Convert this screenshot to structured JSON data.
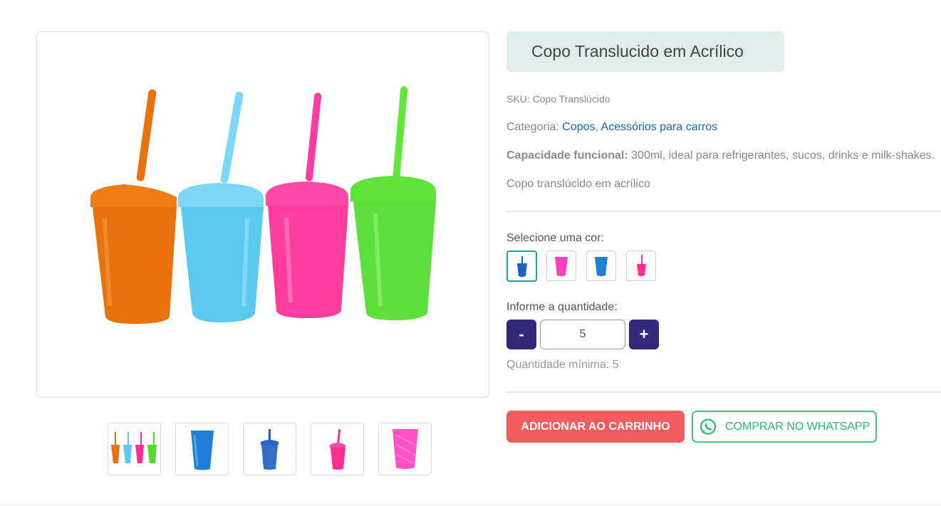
{
  "product": {
    "title": "Copo Translucido em Acrílico",
    "sku_text": "SKU: Copo Translúcido",
    "category_label": "Categoria: ",
    "category_links": [
      "Copos",
      "Acessórios para carros"
    ],
    "category_separator": ", ",
    "capacity_label": "Capacidade funcional:",
    "capacity_text": " 300ml, ideal para refrigerantes, sucos, drinks e milk-shakes.",
    "description": "Copo translúcido em acrílico"
  },
  "color_select": {
    "label": "Selecione uma cor:",
    "options": [
      {
        "name": "Azul escuro com canudo",
        "color": "#1f5fbf",
        "selected": true
      },
      {
        "name": "Rosa",
        "color": "#ff3fbf",
        "selected": false
      },
      {
        "name": "Azul",
        "color": "#1e7fd6",
        "selected": false
      },
      {
        "name": "Rosa com canudo",
        "color": "#ff2e92",
        "selected": false
      }
    ]
  },
  "quantity": {
    "label": "Informe a quantidade:",
    "minus_label": "-",
    "plus_label": "+",
    "value": "5",
    "minimum_text": "Quantidade mínima: 5"
  },
  "actions": {
    "add_to_cart": "ADICIONAR AO CARRINHO",
    "whatsapp": "COMPRAR NO WHATSAPP"
  },
  "gallery": {
    "main_image_cups": [
      "#e8730e",
      "#5ccaf0",
      "#ff2d95",
      "#4fdc2a"
    ],
    "thumbnails": [
      {
        "name": "four-cups",
        "colors": [
          "#e8730e",
          "#5ccaf0",
          "#ff2d95",
          "#4fdc2a"
        ]
      },
      {
        "name": "blue-cup",
        "colors": [
          "#1e7fd6"
        ]
      },
      {
        "name": "dark-blue-cup-straw",
        "colors": [
          "#1f5fbf"
        ]
      },
      {
        "name": "pink-cup-straw",
        "colors": [
          "#ff2e92"
        ]
      },
      {
        "name": "pink-cup",
        "colors": [
          "#ff3fbf"
        ]
      }
    ]
  },
  "colors": {
    "title_bg": "#dfeeeb",
    "link": "#1166cc",
    "qty_button": "#352a7a",
    "cart_button": "#f25c5c",
    "whatsapp": "#25c16b"
  }
}
